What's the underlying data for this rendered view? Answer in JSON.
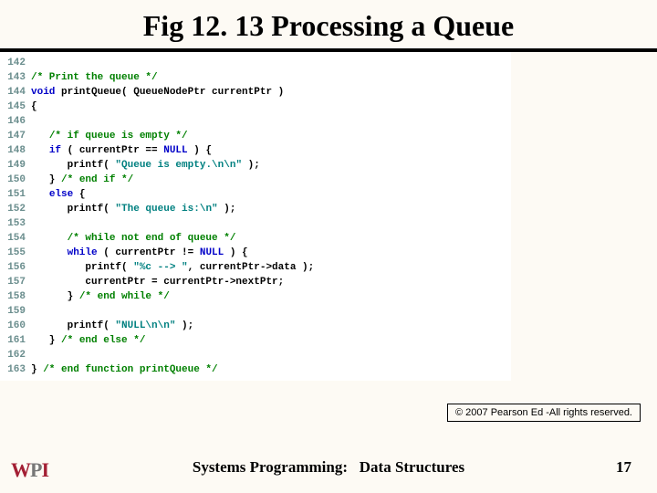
{
  "title": "Fig 12. 13 Processing a Queue",
  "code_lines": [
    {
      "n": "142",
      "segs": []
    },
    {
      "n": "143",
      "segs": [
        {
          "c": "cmt",
          "t": "/* Print the queue */"
        }
      ]
    },
    {
      "n": "144",
      "segs": [
        {
          "c": "kw",
          "t": "void"
        },
        {
          "c": "plain",
          "t": " printQueue( QueueNodePtr currentPtr )"
        }
      ]
    },
    {
      "n": "145",
      "segs": [
        {
          "c": "plain",
          "t": "{"
        }
      ]
    },
    {
      "n": "146",
      "segs": []
    },
    {
      "n": "147",
      "segs": [
        {
          "c": "plain",
          "t": "   "
        },
        {
          "c": "cmt",
          "t": "/* if queue is empty */"
        }
      ]
    },
    {
      "n": "148",
      "segs": [
        {
          "c": "plain",
          "t": "   "
        },
        {
          "c": "kw",
          "t": "if"
        },
        {
          "c": "plain",
          "t": " ( currentPtr == "
        },
        {
          "c": "kw",
          "t": "NULL"
        },
        {
          "c": "plain",
          "t": " ) {"
        }
      ]
    },
    {
      "n": "149",
      "segs": [
        {
          "c": "plain",
          "t": "      printf( "
        },
        {
          "c": "str",
          "t": "\"Queue is empty.\\n\\n\""
        },
        {
          "c": "plain",
          "t": " );"
        }
      ]
    },
    {
      "n": "150",
      "segs": [
        {
          "c": "plain",
          "t": "   } "
        },
        {
          "c": "cmt",
          "t": "/* end if */"
        }
      ]
    },
    {
      "n": "151",
      "segs": [
        {
          "c": "plain",
          "t": "   "
        },
        {
          "c": "kw",
          "t": "else"
        },
        {
          "c": "plain",
          "t": " {"
        }
      ]
    },
    {
      "n": "152",
      "segs": [
        {
          "c": "plain",
          "t": "      printf( "
        },
        {
          "c": "str",
          "t": "\"The queue is:\\n\""
        },
        {
          "c": "plain",
          "t": " );"
        }
      ]
    },
    {
      "n": "153",
      "segs": []
    },
    {
      "n": "154",
      "segs": [
        {
          "c": "plain",
          "t": "      "
        },
        {
          "c": "cmt",
          "t": "/* while not end of queue */"
        }
      ]
    },
    {
      "n": "155",
      "segs": [
        {
          "c": "plain",
          "t": "      "
        },
        {
          "c": "kw",
          "t": "while"
        },
        {
          "c": "plain",
          "t": " ( currentPtr != "
        },
        {
          "c": "kw",
          "t": "NULL"
        },
        {
          "c": "plain",
          "t": " ) {"
        }
      ]
    },
    {
      "n": "156",
      "segs": [
        {
          "c": "plain",
          "t": "         printf( "
        },
        {
          "c": "str",
          "t": "\"%c --> \""
        },
        {
          "c": "plain",
          "t": ", currentPtr->data );"
        }
      ]
    },
    {
      "n": "157",
      "segs": [
        {
          "c": "plain",
          "t": "         currentPtr = currentPtr->nextPtr;"
        }
      ]
    },
    {
      "n": "158",
      "segs": [
        {
          "c": "plain",
          "t": "      } "
        },
        {
          "c": "cmt",
          "t": "/* end while */"
        }
      ]
    },
    {
      "n": "159",
      "segs": []
    },
    {
      "n": "160",
      "segs": [
        {
          "c": "plain",
          "t": "      printf( "
        },
        {
          "c": "str",
          "t": "\"NULL\\n\\n\""
        },
        {
          "c": "plain",
          "t": " );"
        }
      ]
    },
    {
      "n": "161",
      "segs": [
        {
          "c": "plain",
          "t": "   } "
        },
        {
          "c": "cmt",
          "t": "/* end else */"
        }
      ]
    },
    {
      "n": "162",
      "segs": []
    },
    {
      "n": "163",
      "segs": [
        {
          "c": "plain",
          "t": "} "
        },
        {
          "c": "cmt",
          "t": "/* end function printQueue */"
        }
      ]
    }
  ],
  "copyright": "© 2007 Pearson Ed -All rights reserved.",
  "footer_left": "Systems Programming:",
  "footer_right": "Data Structures",
  "page_number": "17",
  "logo": {
    "w": "W",
    "p": "P",
    "i": "I"
  }
}
